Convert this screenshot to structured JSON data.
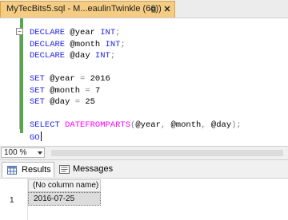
{
  "tab": {
    "title": "MyTecBits5.sql - M...eaulinTwinkle (66))"
  },
  "editor": {
    "declare_year": "DECLARE @year INT;",
    "declare_month": "DECLARE @month INT;",
    "declare_day": "DECLARE @day INT;",
    "set_year": "SET @year = 2016",
    "set_month": "SET @month = 7",
    "set_day": "SET @day = 25",
    "select_line": "SELECT DATEFROMPARTS(@year, @month, @day);",
    "go_line": "GO"
  },
  "zoom": {
    "value": "100 %"
  },
  "results": {
    "tabs": [
      "Results",
      "Messages"
    ],
    "column_header": "(No column name)",
    "row_number": "1",
    "cell_value": "2016-07-25"
  }
}
